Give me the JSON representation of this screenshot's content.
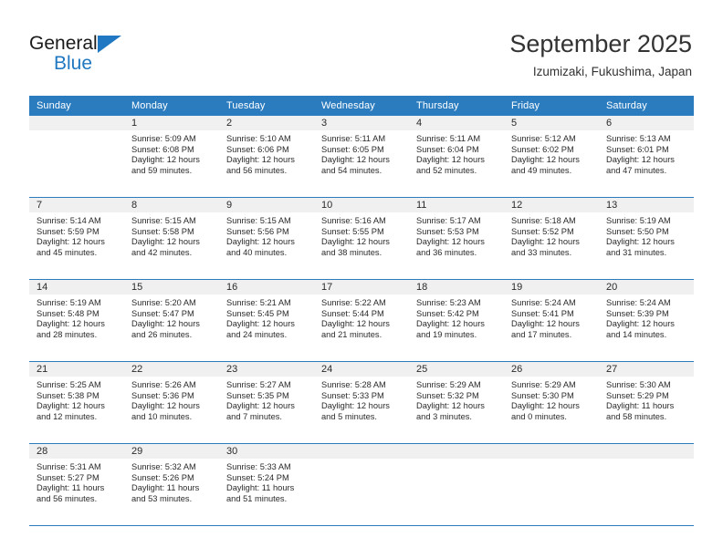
{
  "brand": {
    "name_top": "General",
    "name_bottom": "Blue",
    "accent_color": "#1f78c1",
    "triangle_icon": "triangle-icon"
  },
  "header": {
    "title": "September 2025",
    "subtitle": "Izumizaki, Fukushima, Japan"
  },
  "calendar": {
    "header_bg": "#2b7cbf",
    "daynum_bg": "#f0f0f0",
    "weekdays": [
      "Sunday",
      "Monday",
      "Tuesday",
      "Wednesday",
      "Thursday",
      "Friday",
      "Saturday"
    ],
    "weeks": [
      [
        {
          "day": "",
          "sunrise": "",
          "sunset": "",
          "daylight_line1": "",
          "daylight_line2": ""
        },
        {
          "day": "1",
          "sunrise": "Sunrise: 5:09 AM",
          "sunset": "Sunset: 6:08 PM",
          "daylight_line1": "Daylight: 12 hours",
          "daylight_line2": "and 59 minutes."
        },
        {
          "day": "2",
          "sunrise": "Sunrise: 5:10 AM",
          "sunset": "Sunset: 6:06 PM",
          "daylight_line1": "Daylight: 12 hours",
          "daylight_line2": "and 56 minutes."
        },
        {
          "day": "3",
          "sunrise": "Sunrise: 5:11 AM",
          "sunset": "Sunset: 6:05 PM",
          "daylight_line1": "Daylight: 12 hours",
          "daylight_line2": "and 54 minutes."
        },
        {
          "day": "4",
          "sunrise": "Sunrise: 5:11 AM",
          "sunset": "Sunset: 6:04 PM",
          "daylight_line1": "Daylight: 12 hours",
          "daylight_line2": "and 52 minutes."
        },
        {
          "day": "5",
          "sunrise": "Sunrise: 5:12 AM",
          "sunset": "Sunset: 6:02 PM",
          "daylight_line1": "Daylight: 12 hours",
          "daylight_line2": "and 49 minutes."
        },
        {
          "day": "6",
          "sunrise": "Sunrise: 5:13 AM",
          "sunset": "Sunset: 6:01 PM",
          "daylight_line1": "Daylight: 12 hours",
          "daylight_line2": "and 47 minutes."
        }
      ],
      [
        {
          "day": "7",
          "sunrise": "Sunrise: 5:14 AM",
          "sunset": "Sunset: 5:59 PM",
          "daylight_line1": "Daylight: 12 hours",
          "daylight_line2": "and 45 minutes."
        },
        {
          "day": "8",
          "sunrise": "Sunrise: 5:15 AM",
          "sunset": "Sunset: 5:58 PM",
          "daylight_line1": "Daylight: 12 hours",
          "daylight_line2": "and 42 minutes."
        },
        {
          "day": "9",
          "sunrise": "Sunrise: 5:15 AM",
          "sunset": "Sunset: 5:56 PM",
          "daylight_line1": "Daylight: 12 hours",
          "daylight_line2": "and 40 minutes."
        },
        {
          "day": "10",
          "sunrise": "Sunrise: 5:16 AM",
          "sunset": "Sunset: 5:55 PM",
          "daylight_line1": "Daylight: 12 hours",
          "daylight_line2": "and 38 minutes."
        },
        {
          "day": "11",
          "sunrise": "Sunrise: 5:17 AM",
          "sunset": "Sunset: 5:53 PM",
          "daylight_line1": "Daylight: 12 hours",
          "daylight_line2": "and 36 minutes."
        },
        {
          "day": "12",
          "sunrise": "Sunrise: 5:18 AM",
          "sunset": "Sunset: 5:52 PM",
          "daylight_line1": "Daylight: 12 hours",
          "daylight_line2": "and 33 minutes."
        },
        {
          "day": "13",
          "sunrise": "Sunrise: 5:19 AM",
          "sunset": "Sunset: 5:50 PM",
          "daylight_line1": "Daylight: 12 hours",
          "daylight_line2": "and 31 minutes."
        }
      ],
      [
        {
          "day": "14",
          "sunrise": "Sunrise: 5:19 AM",
          "sunset": "Sunset: 5:48 PM",
          "daylight_line1": "Daylight: 12 hours",
          "daylight_line2": "and 28 minutes."
        },
        {
          "day": "15",
          "sunrise": "Sunrise: 5:20 AM",
          "sunset": "Sunset: 5:47 PM",
          "daylight_line1": "Daylight: 12 hours",
          "daylight_line2": "and 26 minutes."
        },
        {
          "day": "16",
          "sunrise": "Sunrise: 5:21 AM",
          "sunset": "Sunset: 5:45 PM",
          "daylight_line1": "Daylight: 12 hours",
          "daylight_line2": "and 24 minutes."
        },
        {
          "day": "17",
          "sunrise": "Sunrise: 5:22 AM",
          "sunset": "Sunset: 5:44 PM",
          "daylight_line1": "Daylight: 12 hours",
          "daylight_line2": "and 21 minutes."
        },
        {
          "day": "18",
          "sunrise": "Sunrise: 5:23 AM",
          "sunset": "Sunset: 5:42 PM",
          "daylight_line1": "Daylight: 12 hours",
          "daylight_line2": "and 19 minutes."
        },
        {
          "day": "19",
          "sunrise": "Sunrise: 5:24 AM",
          "sunset": "Sunset: 5:41 PM",
          "daylight_line1": "Daylight: 12 hours",
          "daylight_line2": "and 17 minutes."
        },
        {
          "day": "20",
          "sunrise": "Sunrise: 5:24 AM",
          "sunset": "Sunset: 5:39 PM",
          "daylight_line1": "Daylight: 12 hours",
          "daylight_line2": "and 14 minutes."
        }
      ],
      [
        {
          "day": "21",
          "sunrise": "Sunrise: 5:25 AM",
          "sunset": "Sunset: 5:38 PM",
          "daylight_line1": "Daylight: 12 hours",
          "daylight_line2": "and 12 minutes."
        },
        {
          "day": "22",
          "sunrise": "Sunrise: 5:26 AM",
          "sunset": "Sunset: 5:36 PM",
          "daylight_line1": "Daylight: 12 hours",
          "daylight_line2": "and 10 minutes."
        },
        {
          "day": "23",
          "sunrise": "Sunrise: 5:27 AM",
          "sunset": "Sunset: 5:35 PM",
          "daylight_line1": "Daylight: 12 hours",
          "daylight_line2": "and 7 minutes."
        },
        {
          "day": "24",
          "sunrise": "Sunrise: 5:28 AM",
          "sunset": "Sunset: 5:33 PM",
          "daylight_line1": "Daylight: 12 hours",
          "daylight_line2": "and 5 minutes."
        },
        {
          "day": "25",
          "sunrise": "Sunrise: 5:29 AM",
          "sunset": "Sunset: 5:32 PM",
          "daylight_line1": "Daylight: 12 hours",
          "daylight_line2": "and 3 minutes."
        },
        {
          "day": "26",
          "sunrise": "Sunrise: 5:29 AM",
          "sunset": "Sunset: 5:30 PM",
          "daylight_line1": "Daylight: 12 hours",
          "daylight_line2": "and 0 minutes."
        },
        {
          "day": "27",
          "sunrise": "Sunrise: 5:30 AM",
          "sunset": "Sunset: 5:29 PM",
          "daylight_line1": "Daylight: 11 hours",
          "daylight_line2": "and 58 minutes."
        }
      ],
      [
        {
          "day": "28",
          "sunrise": "Sunrise: 5:31 AM",
          "sunset": "Sunset: 5:27 PM",
          "daylight_line1": "Daylight: 11 hours",
          "daylight_line2": "and 56 minutes."
        },
        {
          "day": "29",
          "sunrise": "Sunrise: 5:32 AM",
          "sunset": "Sunset: 5:26 PM",
          "daylight_line1": "Daylight: 11 hours",
          "daylight_line2": "and 53 minutes."
        },
        {
          "day": "30",
          "sunrise": "Sunrise: 5:33 AM",
          "sunset": "Sunset: 5:24 PM",
          "daylight_line1": "Daylight: 11 hours",
          "daylight_line2": "and 51 minutes."
        },
        {
          "day": "",
          "sunrise": "",
          "sunset": "",
          "daylight_line1": "",
          "daylight_line2": ""
        },
        {
          "day": "",
          "sunrise": "",
          "sunset": "",
          "daylight_line1": "",
          "daylight_line2": ""
        },
        {
          "day": "",
          "sunrise": "",
          "sunset": "",
          "daylight_line1": "",
          "daylight_line2": ""
        },
        {
          "day": "",
          "sunrise": "",
          "sunset": "",
          "daylight_line1": "",
          "daylight_line2": ""
        }
      ]
    ]
  }
}
